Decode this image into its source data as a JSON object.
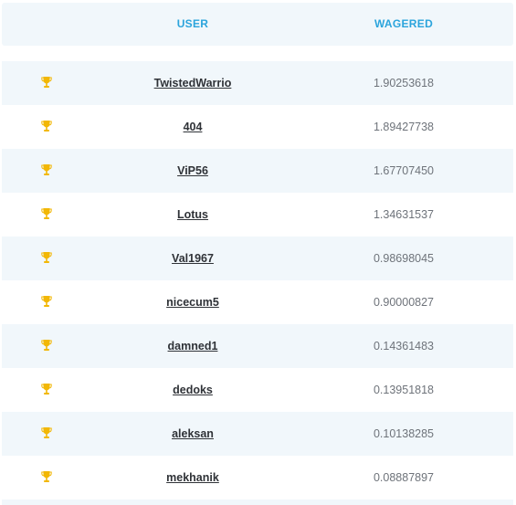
{
  "header": {
    "user_label": "USER",
    "wagered_label": "WAGERED"
  },
  "rows": [
    {
      "user": "TwistedWarrio",
      "wagered": "1.90253618",
      "icon": "trophy-icon"
    },
    {
      "user": "404",
      "wagered": "1.89427738",
      "icon": "trophy-icon"
    },
    {
      "user": "ViP56",
      "wagered": "1.67707450",
      "icon": "trophy-icon"
    },
    {
      "user": "Lotus",
      "wagered": "1.34631537",
      "icon": "trophy-icon"
    },
    {
      "user": "Val1967",
      "wagered": "0.98698045",
      "icon": "trophy-icon"
    },
    {
      "user": "nicecum5",
      "wagered": "0.90000827",
      "icon": "trophy-icon"
    },
    {
      "user": "damned1",
      "wagered": "0.14361483",
      "icon": "trophy-icon"
    },
    {
      "user": "dedoks",
      "wagered": "0.13951818",
      "icon": "trophy-icon"
    },
    {
      "user": "aleksan",
      "wagered": "0.10138285",
      "icon": "trophy-icon"
    },
    {
      "user": "mekhanik",
      "wagered": "0.08887897",
      "icon": "trophy-icon"
    }
  ],
  "colors": {
    "header_text": "#2ba4dc",
    "row_stripe": "#f1f7fb",
    "trophy": "#f2b705",
    "username": "#2f3237",
    "wagered": "#6e737a"
  }
}
